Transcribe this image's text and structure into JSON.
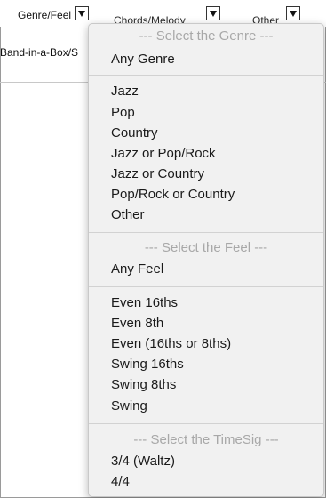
{
  "toolbar": {
    "genre_feel_label": "Genre/Feel",
    "chords_melody_label": "Chords/Melody",
    "other_label": "Other"
  },
  "list_header": {
    "partial_text": "Band-in-a-Box/S"
  },
  "menu": {
    "genre_header": "--- Select the Genre ---",
    "any_genre": "Any Genre",
    "genres": [
      "Jazz",
      "Pop",
      "Country",
      "Jazz or Pop/Rock",
      "Jazz or Country",
      "Pop/Rock or Country",
      "Other"
    ],
    "feel_header": "--- Select the Feel ---",
    "any_feel": "Any Feel",
    "feels": [
      "Even 16ths",
      "Even 8th",
      "Even (16ths or 8ths)",
      "Swing 16ths",
      "Swing 8ths",
      "Swing"
    ],
    "timesig_header": "--- Select the TimeSig ---",
    "timesigs": [
      "3/4 (Waltz)",
      "4/4"
    ]
  }
}
